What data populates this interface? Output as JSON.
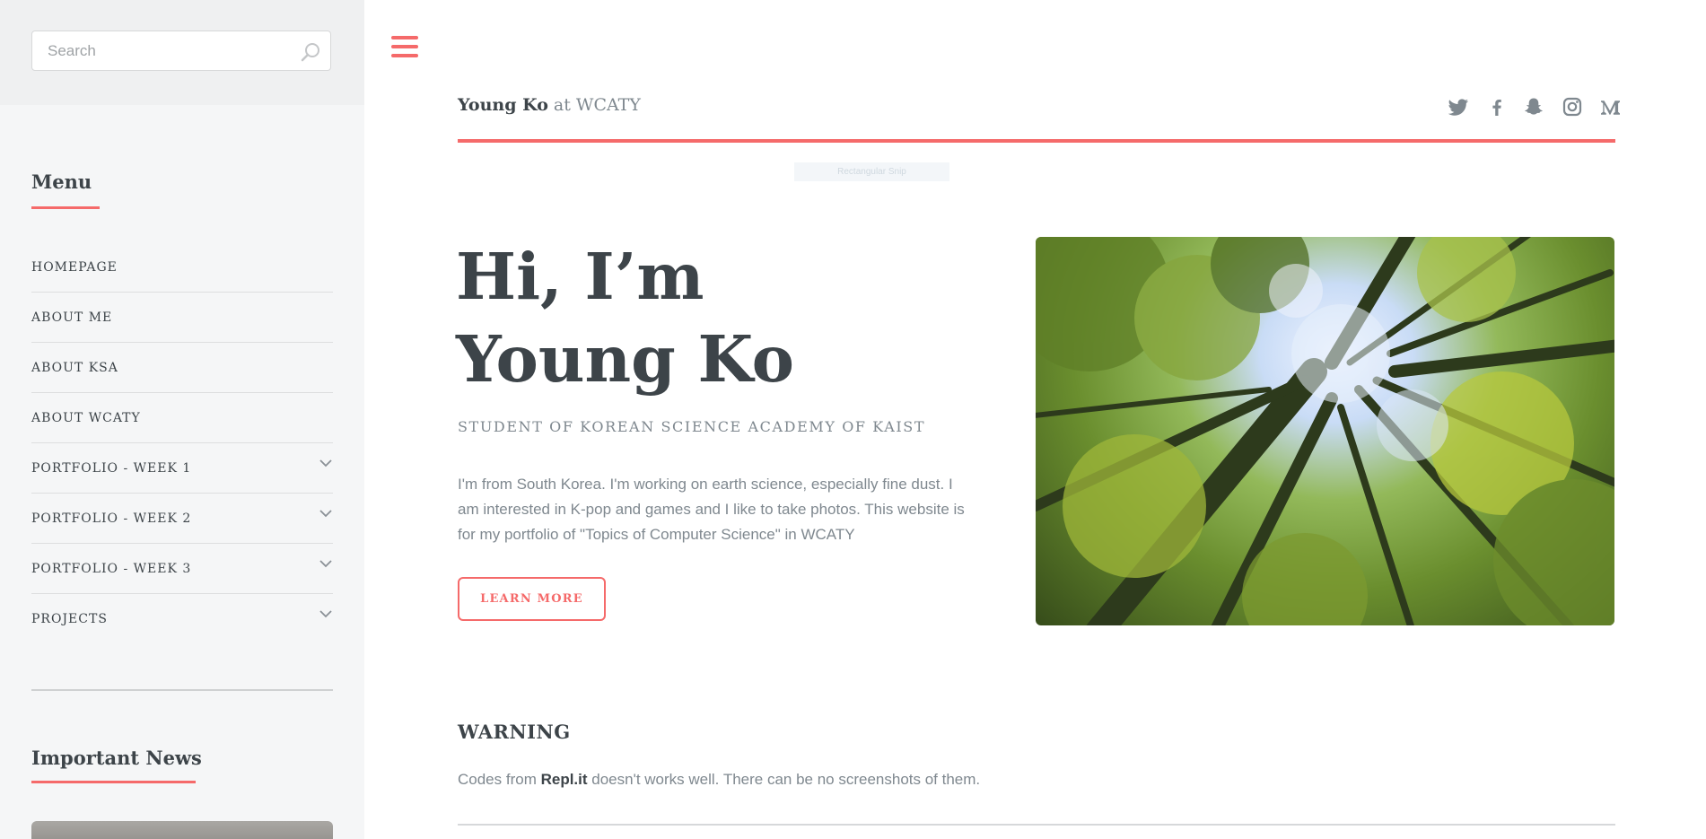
{
  "search": {
    "placeholder": "Search"
  },
  "menu": {
    "heading": "Menu",
    "items": [
      {
        "label": "HOMEPAGE",
        "has_submenu": false
      },
      {
        "label": "ABOUT ME",
        "has_submenu": false
      },
      {
        "label": "ABOUT KSA",
        "has_submenu": false
      },
      {
        "label": "ABOUT WCATY",
        "has_submenu": false
      },
      {
        "label": "PORTFOLIO - WEEK 1",
        "has_submenu": true
      },
      {
        "label": "PORTFOLIO - WEEK 2",
        "has_submenu": true
      },
      {
        "label": "PORTFOLIO - WEEK 3",
        "has_submenu": true
      },
      {
        "label": "PROJECTS",
        "has_submenu": true
      }
    ]
  },
  "news": {
    "heading": "Important News"
  },
  "header": {
    "name": "Young Ko",
    "suffix": " at WCATY",
    "social": [
      "twitter-icon",
      "facebook-icon",
      "snapchat-icon",
      "instagram-icon",
      "medium-icon"
    ]
  },
  "snip_label": "Rectangular Snip",
  "hero": {
    "title_line1": "Hi, I’m",
    "title_line2": "Young Ko",
    "subtitle": "STUDENT OF KOREAN SCIENCE ACADEMY OF KAIST",
    "text": "I'm from South Korea. I'm working on earth science, especially fine dust. I am interested in K-pop and games and I like to take photos. This website is for my portfolio of \"Topics of Computer Science\" in WCATY",
    "button": "LEARN MORE"
  },
  "warning": {
    "title": "WARNING",
    "text_before": "Codes from ",
    "link": "Repl.it",
    "text_after": " doesn't works well. There can be no screenshots of them."
  },
  "colors": {
    "accent": "#f56a6a",
    "text": "#3d4449",
    "muted": "#7f888f",
    "sidebar_bg": "#f5f6f7"
  }
}
